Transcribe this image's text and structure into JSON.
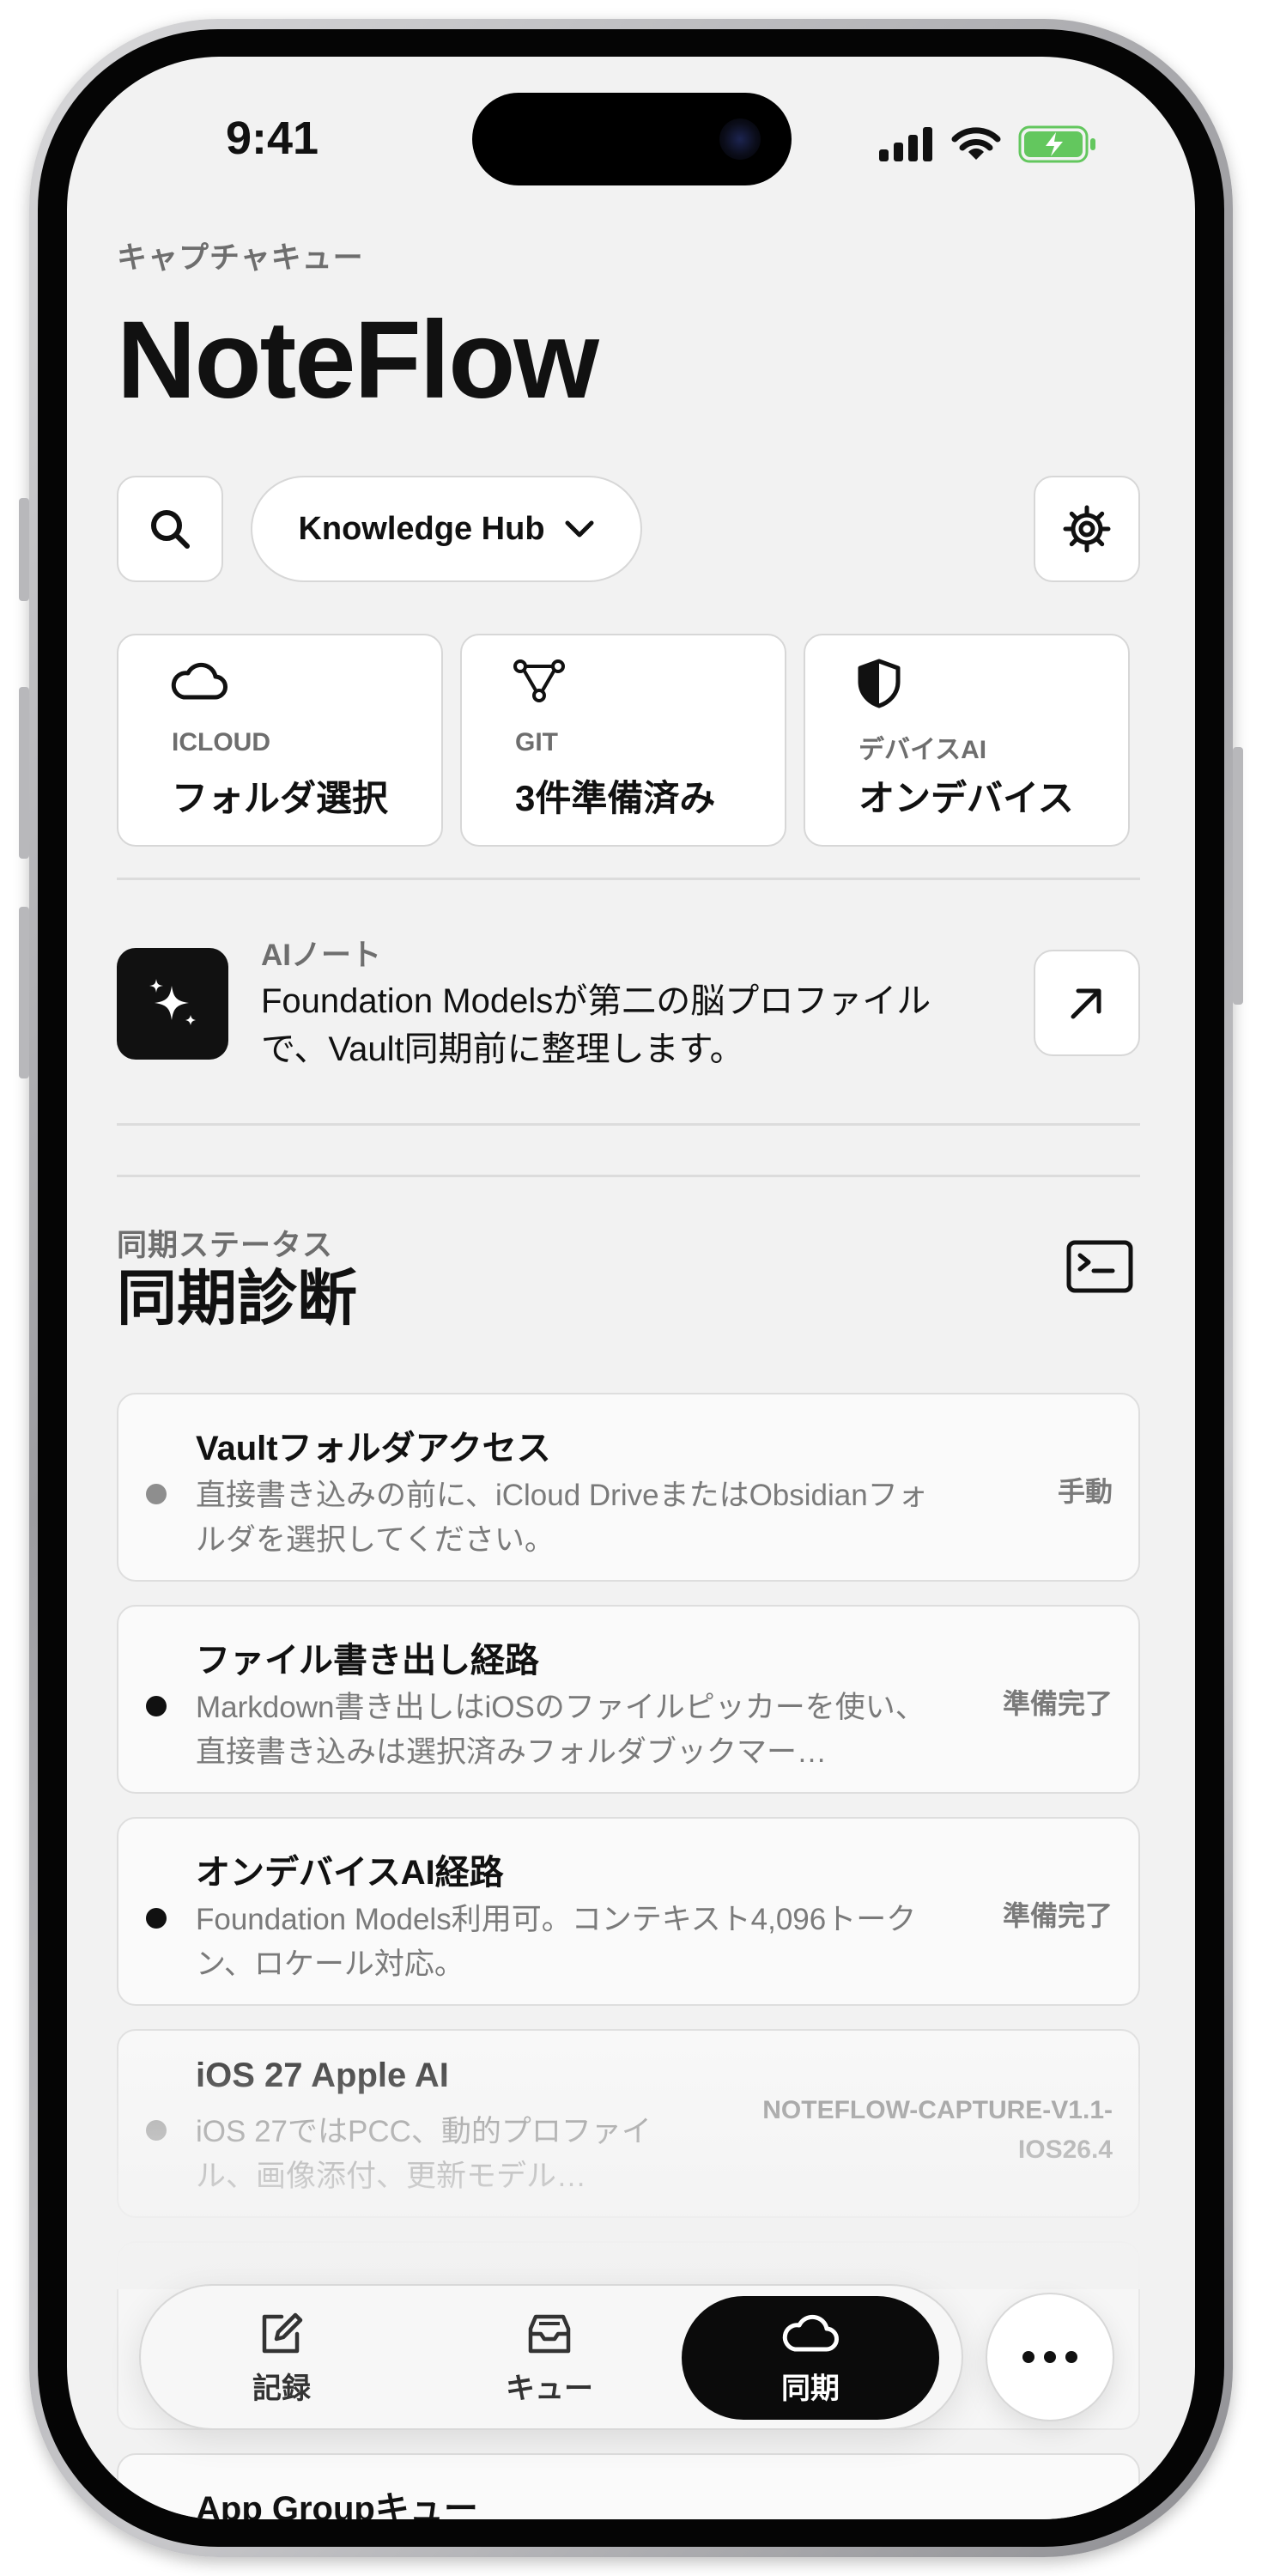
{
  "status_bar": {
    "time": "9:41"
  },
  "header": {
    "eyebrow": "キャプチャキュー",
    "title": "NoteFlow"
  },
  "toolbar": {
    "vault_selector": "Knowledge Hub"
  },
  "info_cards": [
    {
      "icon": "cloud-icon",
      "label": "ICLOUD",
      "value": "フォルダ選択"
    },
    {
      "icon": "git-branch-icon",
      "label": "GIT",
      "value": "3件準備済み"
    },
    {
      "icon": "shield-icon",
      "label": "デバイスAI",
      "value": "オンデバイス"
    }
  ],
  "ai_note": {
    "label": "AIノート",
    "body": "Foundation Modelsが第二の脳プロファイルで、Vault同期前に整理します。"
  },
  "sync": {
    "eyebrow": "同期ステータス",
    "title": "同期診断",
    "rows": [
      {
        "title": "Vaultフォルダアクセス",
        "description": "直接書き込みの前に、iCloud DriveまたはObsidianフォルダを選択してください。",
        "status": "手動",
        "dot_color": "#8e8e8e"
      },
      {
        "title": "ファイル書き出し経路",
        "description": "Markdown書き出しはiOSのファイルピッカーを使い、直接書き込みは選択済みフォルダブックマー…",
        "status": "準備完了",
        "dot_color": "#111111"
      },
      {
        "title": "オンデバイスAI経路",
        "description": "Foundation Models利用可。コンテキスト4,096トークン、ロケール対応。",
        "status": "準備完了",
        "dot_color": "#111111"
      },
      {
        "title": "iOS 27 Apple AI",
        "description": "iOS 27ではPCC、動的プロファイル、画像添付、更新モデル…",
        "status": "NOTEFLOW-CAPTURE-V1.1-IOS26.4",
        "dot_color": "#8e8e8e"
      },
      {
        "title": "",
        "description": "",
        "status": "",
        "dot_color": "#bbbbbb"
      },
      {
        "title": "App Groupキュー",
        "description": "",
        "status": "",
        "dot_color": "#8e8e8e"
      }
    ]
  },
  "tab_bar": {
    "tabs": [
      {
        "label": "記録",
        "icon": "compose-icon"
      },
      {
        "label": "キュー",
        "icon": "tray-icon"
      },
      {
        "label": "同期",
        "icon": "cloud-icon"
      }
    ],
    "active_tab": "同期",
    "more_icon": "ellipsis-icon"
  }
}
